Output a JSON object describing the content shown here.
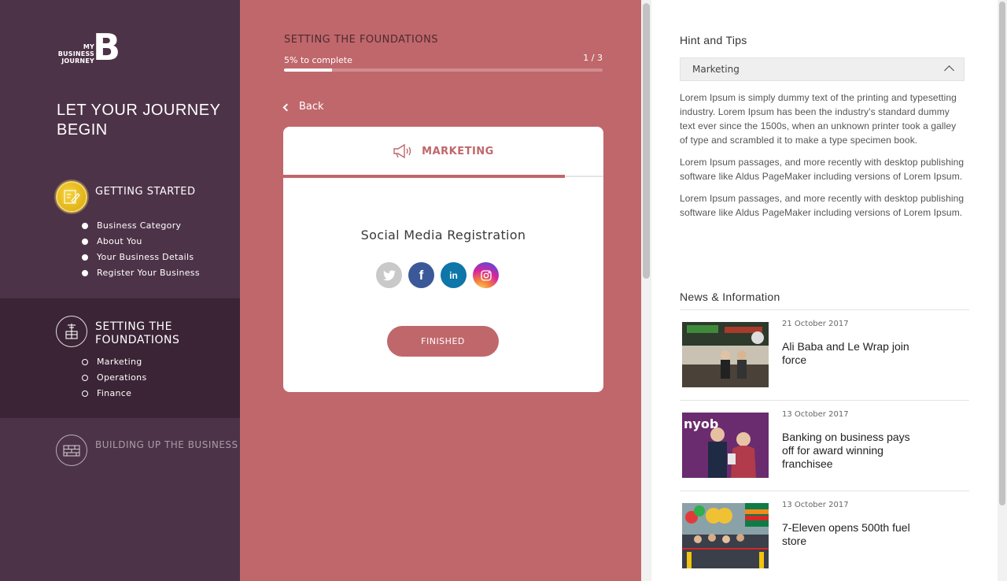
{
  "brand": {
    "logo_text": "MY BUSINESS JOURNEY",
    "logo_mark": "B"
  },
  "sidebar": {
    "tagline": "LET YOUR JOURNEY BEGIN",
    "stages": [
      {
        "title": "GETTING STARTED",
        "icon": "checklist-pencil-icon",
        "state": "completed",
        "steps": [
          {
            "label": "Business Category",
            "done": true
          },
          {
            "label": "About You",
            "done": true
          },
          {
            "label": "Your Business Details",
            "done": true
          },
          {
            "label": "Register Your Business",
            "done": true
          }
        ]
      },
      {
        "title": "SETTING THE FOUNDATIONS",
        "icon": "crane-building-icon",
        "state": "active",
        "steps": [
          {
            "label": "Marketing",
            "done": false
          },
          {
            "label": "Operations",
            "done": false
          },
          {
            "label": "Finance",
            "done": false
          }
        ]
      },
      {
        "title": "BUILDING UP THE BUSINESS",
        "icon": "brick-wall-icon",
        "state": "locked",
        "steps": []
      }
    ]
  },
  "main": {
    "section_title": "SETTING THE FOUNDATIONS",
    "progress_label": "5% to complete",
    "progress_value": 0.15,
    "progress_count": "1 / 3",
    "back_label": "Back",
    "card": {
      "tab_label": "MARKETING",
      "tab_icon": "megaphone-icon",
      "tab_progress": 0.88,
      "title": "Social Media Registration",
      "socials": [
        {
          "name": "twitter",
          "icon": "twitter-icon",
          "color": "#c9c9c9"
        },
        {
          "name": "facebook",
          "icon": "facebook-icon",
          "color": "#3b5998"
        },
        {
          "name": "linkedin",
          "icon": "linkedin-icon",
          "color": "#0e76a8"
        },
        {
          "name": "instagram",
          "icon": "instagram-icon",
          "color": "#d6249f"
        }
      ],
      "finish_label": "FINISHED"
    }
  },
  "aside": {
    "hints_title": "Hint and Tips",
    "hints_dropdown": "Marketing",
    "paragraphs": [
      "Lorem Ipsum is simply dummy text of the printing and typesetting industry. Lorem Ipsum has been the industry's standard dummy text ever since the 1500s, when an unknown printer took a galley of type and scrambled it to make a type specimen book.",
      "Lorem Ipsum passages, and more recently with desktop publishing software like Aldus PageMaker including versions of Lorem Ipsum.",
      "Lorem Ipsum passages, and more recently with desktop publishing software like Aldus PageMaker including versions of Lorem Ipsum."
    ],
    "news_title": "News & Information",
    "news": [
      {
        "date": "21 October 2017",
        "title": "Ali Baba and Le Wrap join force"
      },
      {
        "date": "13 October 2017",
        "title": "Banking on business pays off for award winning franchisee"
      },
      {
        "date": "13 October 2017",
        "title": "7-Eleven opens 500th fuel store"
      }
    ]
  },
  "colors": {
    "sidebar": "#4d3348",
    "sidebar_active": "#3b2436",
    "accent": "#c0676b",
    "gold": "#f6d23b"
  }
}
